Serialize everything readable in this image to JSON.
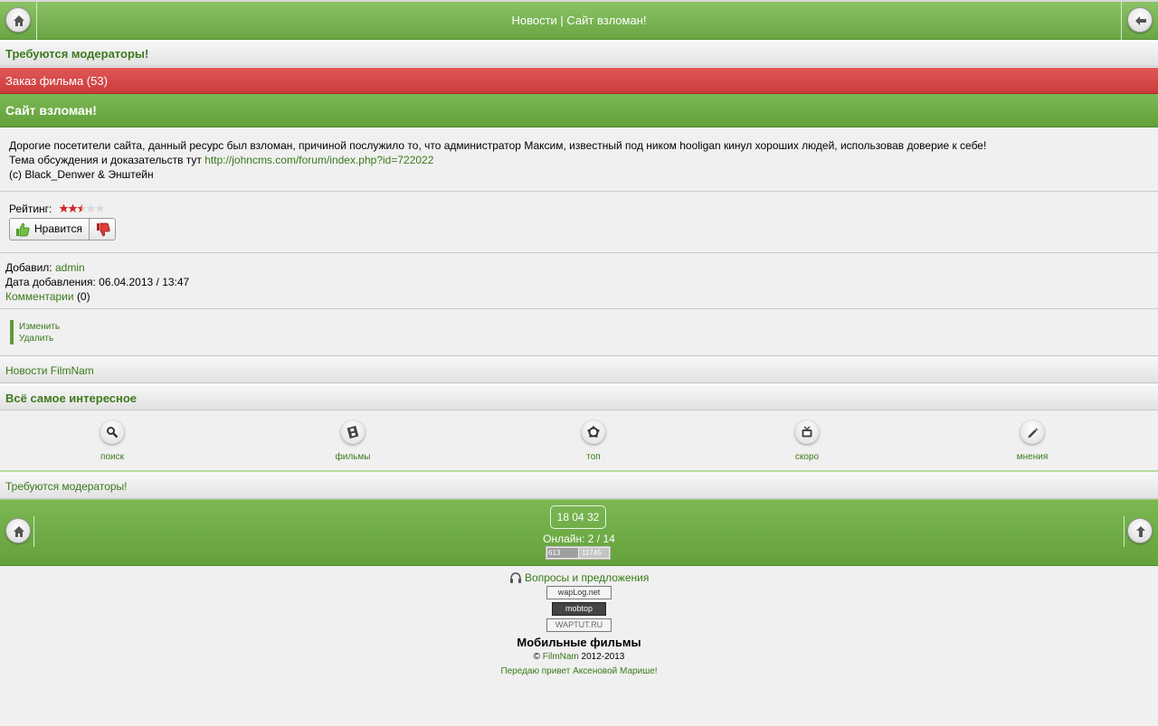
{
  "header": {
    "title": "Новости | Сайт взломан!",
    "home_icon": "home-icon",
    "back_icon": "back-arrow-icon"
  },
  "notice_top": "Требуются модераторы!",
  "order_bar": "Заказ фильма (53)",
  "post": {
    "title": "Сайт взломан!",
    "line1": "Дорогие посетители сайта, данный ресурс был взломан, причиной послужило то, что администратор Максим, известный под ником hooligan кинул хороших людей, использовав доверие к себе!",
    "line2_prefix": "Тема обсуждения и доказательств тут ",
    "line2_link": "http://johncms.com/forum/index.php?id=722022",
    "line3": "(c) Black_Denwer & Энштейн"
  },
  "rating": {
    "label": "Рейтинг:",
    "value": 2.5,
    "max": 5,
    "like_label": "Нравится",
    "like_icon": "thumbs-up-icon",
    "dislike_icon": "thumbs-down-icon"
  },
  "meta": {
    "added_by_label": "Добавил:",
    "added_by_value": "admin",
    "date_label": "Дата добавления:",
    "date_value": "06.04.2013 / 13:47",
    "comments_label": "Комментарии",
    "comments_count": "(0)"
  },
  "admin_actions": {
    "edit": "Изменить",
    "delete": "Удалить"
  },
  "news_link": "Новости FilmNam",
  "interesting_header": "Всё самое интересное",
  "nav_icons": [
    {
      "label": "поиск",
      "icon": "search-icon"
    },
    {
      "label": "фильмы",
      "icon": "film-icon"
    },
    {
      "label": "топ",
      "icon": "top-icon"
    },
    {
      "label": "скоро",
      "icon": "tv-icon"
    },
    {
      "label": "мнения",
      "icon": "pencil-icon"
    }
  ],
  "notice_bottom": "Требуются модераторы!",
  "footer": {
    "time": "18 04 32",
    "online": "Онлайн: 2 / 14",
    "counter_a": "613",
    "counter_b": "11745",
    "feedback": "Вопросы и предложения",
    "badges": [
      "wapLog.net",
      "mobtop",
      "WAPTUT.RU"
    ],
    "site_name": "Мобильные фильмы",
    "copyright_symbol": "©",
    "copyright_link": "FilmNam",
    "copyright_years": "2012-2013",
    "greeting": "Передаю привет Аксеновой Марише!"
  },
  "colors": {
    "green": "#6aa644",
    "red": "#cc3c3c",
    "link": "#3a7a1a",
    "background": "#f0f0f0"
  }
}
